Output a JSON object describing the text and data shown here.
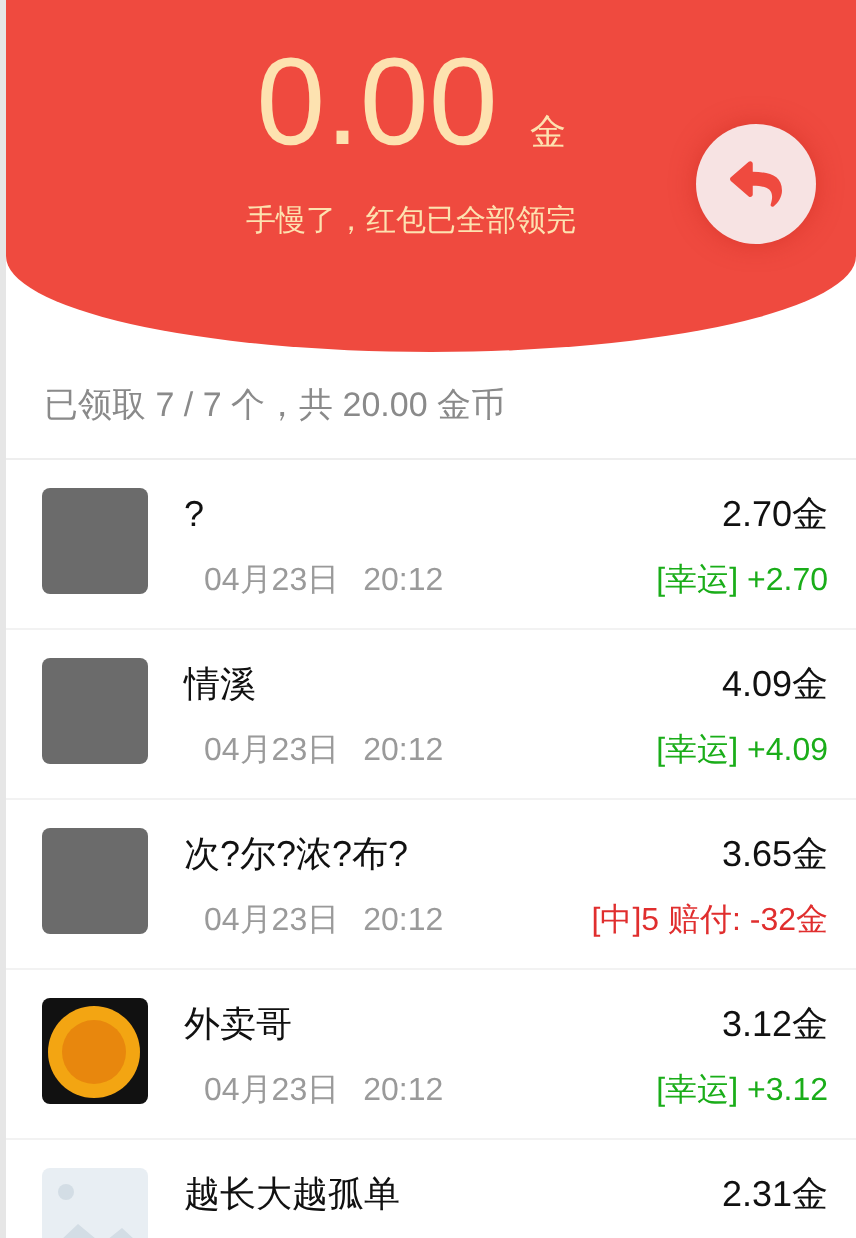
{
  "header": {
    "amount": "0.00",
    "unit": "金",
    "message": "手慢了，红包已全部领完"
  },
  "summary": "已领取 7 / 7 个，共 20.00 金币",
  "records": [
    {
      "avatar": {
        "kind": "photo"
      },
      "name": "?",
      "date": "04月23日",
      "time": "20:12",
      "amount": "2.70金",
      "result": "[幸运] +2.70",
      "kind": "lucky"
    },
    {
      "avatar": {
        "kind": "photo"
      },
      "name": "情溪",
      "date": "04月23日",
      "time": "20:12",
      "amount": "4.09金",
      "result": "[幸运] +4.09",
      "kind": "lucky"
    },
    {
      "avatar": {
        "kind": "photo"
      },
      "name": "次?尔?浓?布?",
      "date": "04月23日",
      "time": "20:12",
      "amount": "3.65金",
      "result": "[中]5 赔付: -32金",
      "kind": "penalty"
    },
    {
      "avatar": {
        "kind": "coin"
      },
      "name": "外卖哥",
      "date": "04月23日",
      "time": "20:12",
      "amount": "3.12金",
      "result": "[幸运] +3.12",
      "kind": "lucky"
    },
    {
      "avatar": {
        "kind": "placeholder"
      },
      "name": "越长大越孤单",
      "amount": "2.31金"
    }
  ]
}
